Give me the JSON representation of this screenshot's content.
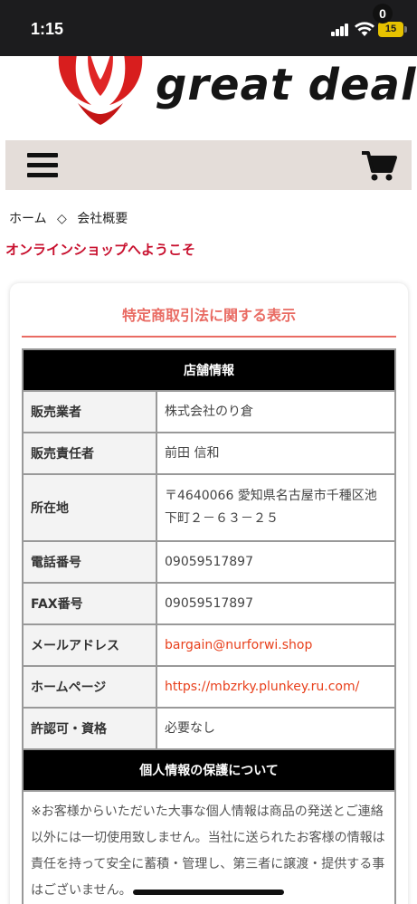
{
  "status_bar": {
    "time": "1:15",
    "battery": "15"
  },
  "logo": {
    "text": "great deal"
  },
  "nav": {
    "cart_count": "0"
  },
  "breadcrumb": {
    "home": "ホーム",
    "separator": "◇",
    "current": "会社概要"
  },
  "welcome": "オンラインショップへようこそ",
  "card": {
    "title": "特定商取引法に関する表示",
    "store_section": "店舗情報",
    "rows": [
      {
        "label": "販売業者",
        "value": "株式会社のり倉"
      },
      {
        "label": "販売責任者",
        "value": "前田 信和"
      },
      {
        "label": "所在地",
        "value": "〒4640066 愛知県名古屋市千種区池下町２－６３－２５"
      },
      {
        "label": "電話番号",
        "value": "09059517897"
      },
      {
        "label": "FAX番号",
        "value": "09059517897"
      },
      {
        "label": "メールアドレス",
        "value": "bargain@nurforwi.shop"
      },
      {
        "label": "ホームページ",
        "value": "https://mbzrky.plunkey.ru.com/"
      },
      {
        "label": "許認可・資格",
        "value": "必要なし"
      }
    ],
    "privacy_section": "個人情報の保護について",
    "privacy_text": "※お客様からいただいた大事な個人情報は商品の発送とご連絡以外には一切使用致しません。当社に送られたお客様の情報は責任を持って安全に蓄積・管理し、第三者に譲渡・提供する事はございません。"
  },
  "colors": {
    "accent": "#e96b63",
    "welcome": "#c8102e",
    "link": "#e8401c",
    "nav_bg": "#e4ddd9"
  },
  "icons": {
    "menu": "hamburger-icon",
    "cart": "cart-icon",
    "logo": "phoenix-logo-icon"
  }
}
